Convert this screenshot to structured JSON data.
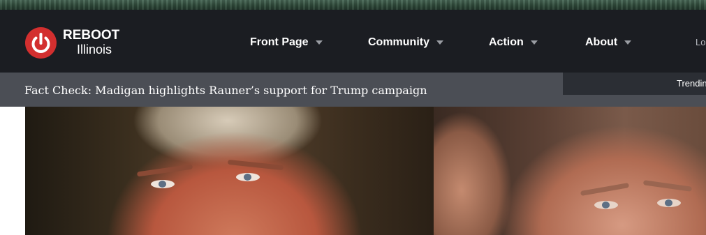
{
  "brand": {
    "name_line1": "REBOOT",
    "name_line2": "Illinois",
    "mark_icon": "power-icon",
    "mark_color": "#d32f2f"
  },
  "nav": {
    "items": [
      {
        "label": "Front Page"
      },
      {
        "label": "Community"
      },
      {
        "label": "Action"
      },
      {
        "label": "About"
      }
    ],
    "login_partial": "Lo"
  },
  "subbar": {
    "headline": "Fact Check: Madigan highlights Rauner’s support for Trump campaign",
    "trending_partial": "Trendin"
  },
  "colors": {
    "nav_bg": "#1b1d22",
    "subbar_bg": "#4b4e55",
    "trending_bg": "#2b2e34"
  }
}
